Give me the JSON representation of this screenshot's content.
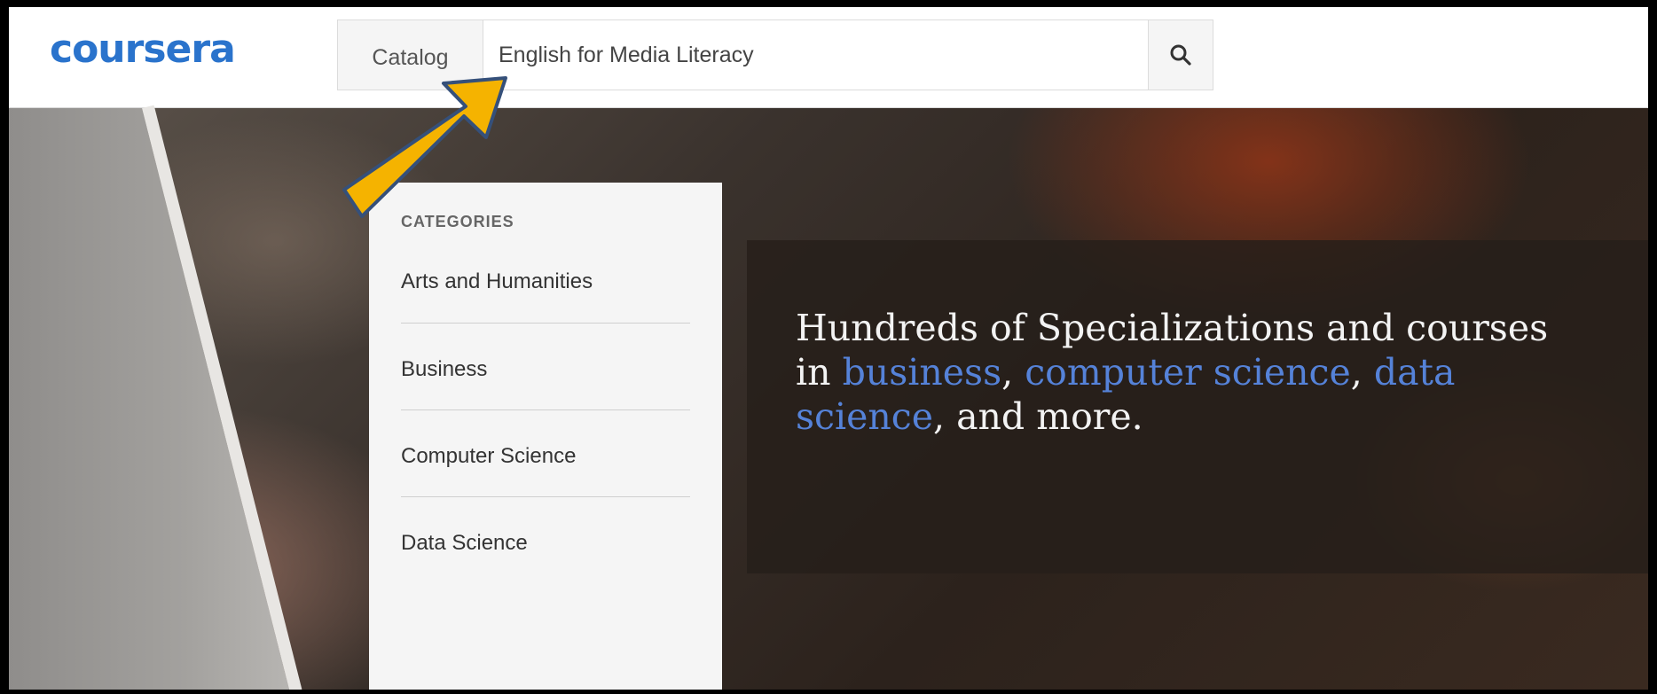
{
  "header": {
    "logo_text": "coursera",
    "brand_color": "#2a73cc",
    "search": {
      "catalog_label": "Catalog",
      "value": "English for Media Literacy",
      "icon": "search-icon"
    }
  },
  "categories": {
    "heading": "CATEGORIES",
    "items": [
      {
        "label": "Arts and Humanities"
      },
      {
        "label": "Business"
      },
      {
        "label": "Computer Science"
      },
      {
        "label": "Data Science"
      }
    ]
  },
  "promo": {
    "text_1": "Hundreds of Specializations and courses in ",
    "link_business": "business",
    "text_2": ", ",
    "link_cs": "computer science",
    "text_3": ", ",
    "link_ds": "data science",
    "text_4": ", and more.",
    "link_color": "#5582d8"
  },
  "annotation": {
    "arrow_color": "#f5b300",
    "arrow_outline": "#35507a"
  }
}
